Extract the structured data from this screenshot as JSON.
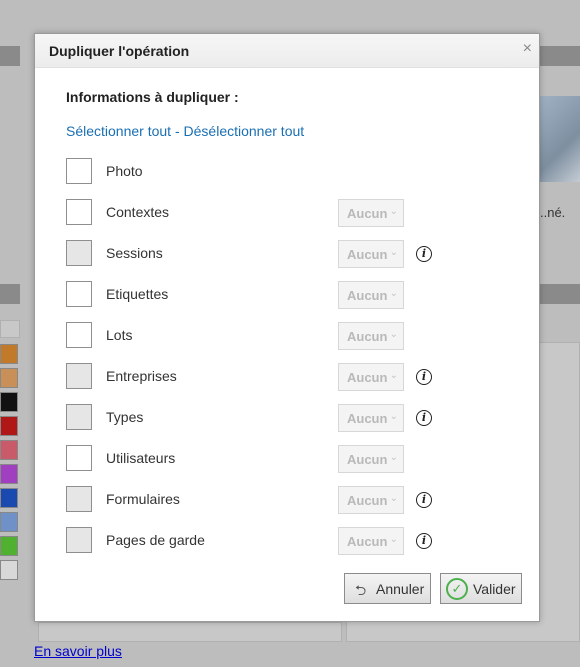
{
  "background": {
    "text_fragment": "..né.",
    "footer_link": "En savoir plus",
    "swatch_colors": [
      "#c07a2a",
      "#c89058",
      "#111111",
      "#b01818",
      "#c85a6a",
      "#a040c0",
      "#1a4ab0",
      "#7090c8",
      "#50b030",
      "#d8d8d8"
    ]
  },
  "dialog": {
    "title": "Dupliquer l'opération",
    "close_symbol": "×",
    "section_title": "Informations à dupliquer :",
    "select_all": "Sélectionner tout",
    "separator": " - ",
    "deselect_all": "Désélectionner tout",
    "items": [
      {
        "label": "Photo",
        "dropdown": null,
        "info": false,
        "disabled": false
      },
      {
        "label": "Contextes",
        "dropdown": "Aucun",
        "info": false,
        "disabled": false
      },
      {
        "label": "Sessions",
        "dropdown": "Aucun",
        "info": true,
        "disabled": true
      },
      {
        "label": "Etiquettes",
        "dropdown": "Aucun",
        "info": false,
        "disabled": false
      },
      {
        "label": "Lots",
        "dropdown": "Aucun",
        "info": false,
        "disabled": false
      },
      {
        "label": "Entreprises",
        "dropdown": "Aucun",
        "info": true,
        "disabled": true
      },
      {
        "label": "Types",
        "dropdown": "Aucun",
        "info": true,
        "disabled": true
      },
      {
        "label": "Utilisateurs",
        "dropdown": "Aucun",
        "info": false,
        "disabled": false
      },
      {
        "label": "Formulaires",
        "dropdown": "Aucun",
        "info": true,
        "disabled": true
      },
      {
        "label": "Pages de garde",
        "dropdown": "Aucun",
        "info": true,
        "disabled": true
      }
    ],
    "cancel_label": "Annuler",
    "validate_label": "Valider"
  }
}
